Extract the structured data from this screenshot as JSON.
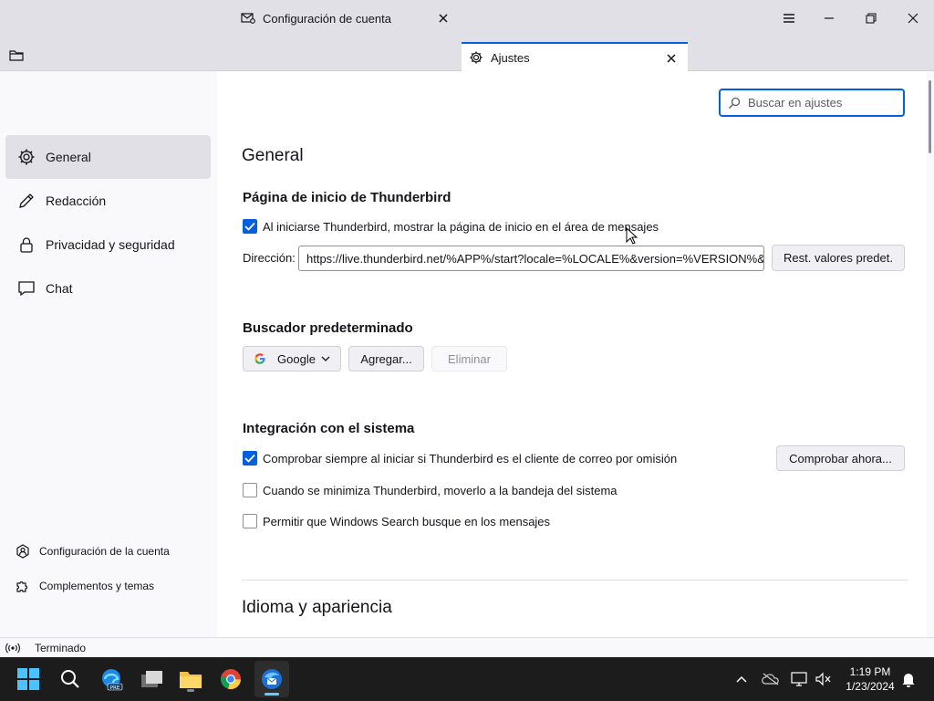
{
  "tabs": [
    {
      "label": "Configuración de cuenta"
    },
    {
      "label": "Ajustes"
    }
  ],
  "sidebar": {
    "categories": [
      {
        "label": "General",
        "icon": "gear-icon"
      },
      {
        "label": "Redacción",
        "icon": "pencil-icon"
      },
      {
        "label": "Privacidad y seguridad",
        "icon": "lock-icon"
      },
      {
        "label": "Chat",
        "icon": "chat-icon"
      }
    ],
    "footer": [
      {
        "label": "Configuración de la cuenta",
        "icon": "account-settings-icon"
      },
      {
        "label": "Complementos y temas",
        "icon": "puzzle-icon"
      }
    ]
  },
  "search": {
    "placeholder": "Buscar en ajustes"
  },
  "main": {
    "title": "General",
    "start_page": {
      "heading": "Página de inicio de Thunderbird",
      "checkbox_label": "Al iniciarse Thunderbird, mostrar la página de inicio en el área de mensajes",
      "checked": true,
      "address_label": "Dirección:",
      "address_value": "https://live.thunderbird.net/%APP%/start?locale=%LOCALE%&version=%VERSION%&",
      "reset_label": "Rest. valores predet."
    },
    "search_engine": {
      "heading": "Buscador predeterminado",
      "selected": "Google",
      "add_label": "Agregar...",
      "remove_label": "Eliminar"
    },
    "system": {
      "heading": "Integración con el sistema",
      "check_default": "Comprobar siempre al iniciar si Thunderbird es el cliente de correo por omisión",
      "check_now_label": "Comprobar ahora...",
      "minimize_tray": "Cuando se minimiza Thunderbird, moverlo a la bandeja del sistema",
      "windows_search": "Permitir que Windows Search busque en los mensajes"
    },
    "language_heading": "Idioma y apariencia"
  },
  "status": {
    "text": "Terminado"
  },
  "clock": {
    "time": "1:19 PM",
    "date": "1/23/2024"
  },
  "colors": {
    "accent": "#0060df",
    "sidebar_selected": "#e0e0e6"
  }
}
